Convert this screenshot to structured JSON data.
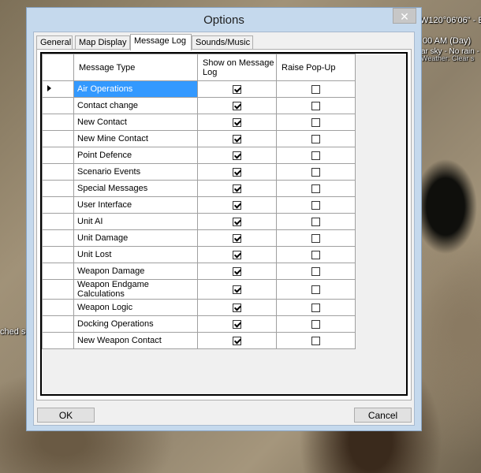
{
  "map": {
    "coord_text": "W120°06'06\" - E",
    "time_text": "00 AM (Day)",
    "weather_text": "ar sky - No rain -",
    "weather_text2": "Weather: Clear s",
    "left_text": "ched s"
  },
  "window": {
    "title": "Options",
    "close_label": "✕"
  },
  "tabs": [
    {
      "label": "General"
    },
    {
      "label": "Map Display"
    },
    {
      "label": "Message Log"
    },
    {
      "label": "Sounds/Music"
    }
  ],
  "grid": {
    "headers": {
      "type": "Message Type",
      "show": "Show on Message Log",
      "popup": "Raise Pop-Up"
    },
    "rows": [
      {
        "type": "Air Operations",
        "show": true,
        "popup": false
      },
      {
        "type": "Contact change",
        "show": true,
        "popup": false
      },
      {
        "type": "New Contact",
        "show": true,
        "popup": false
      },
      {
        "type": "New Mine Contact",
        "show": true,
        "popup": false
      },
      {
        "type": "Point Defence",
        "show": true,
        "popup": false
      },
      {
        "type": "Scenario Events",
        "show": true,
        "popup": false
      },
      {
        "type": "Special Messages",
        "show": true,
        "popup": false
      },
      {
        "type": "User Interface",
        "show": true,
        "popup": false
      },
      {
        "type": "Unit AI",
        "show": true,
        "popup": false
      },
      {
        "type": "Unit Damage",
        "show": true,
        "popup": false
      },
      {
        "type": "Unit Lost",
        "show": true,
        "popup": false
      },
      {
        "type": "Weapon Damage",
        "show": true,
        "popup": false
      },
      {
        "type": "Weapon Endgame Calculations",
        "show": true,
        "popup": false
      },
      {
        "type": "Weapon Logic",
        "show": true,
        "popup": false
      },
      {
        "type": "Docking Operations",
        "show": true,
        "popup": false
      },
      {
        "type": "New Weapon Contact",
        "show": true,
        "popup": false
      }
    ]
  },
  "buttons": {
    "ok": "OK",
    "cancel": "Cancel"
  }
}
